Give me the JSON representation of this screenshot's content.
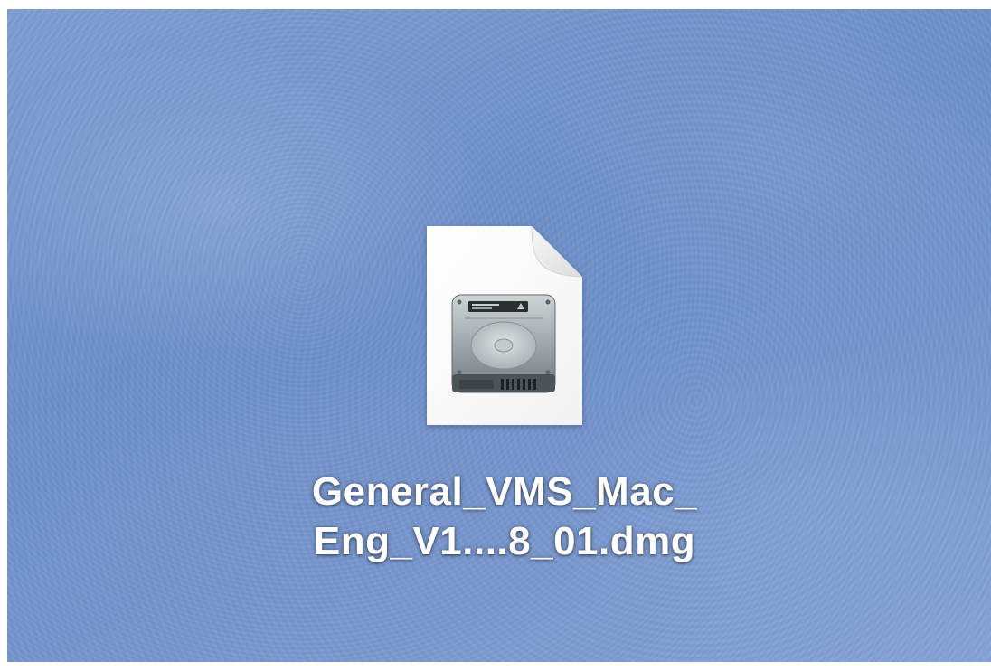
{
  "desktop": {
    "background_color": "#7595cd",
    "items": [
      {
        "icon": "disk-image-file-icon",
        "name_line1": "General_VMS_Mac_",
        "name_line2": "Eng_V1....8_01.dmg"
      }
    ]
  }
}
